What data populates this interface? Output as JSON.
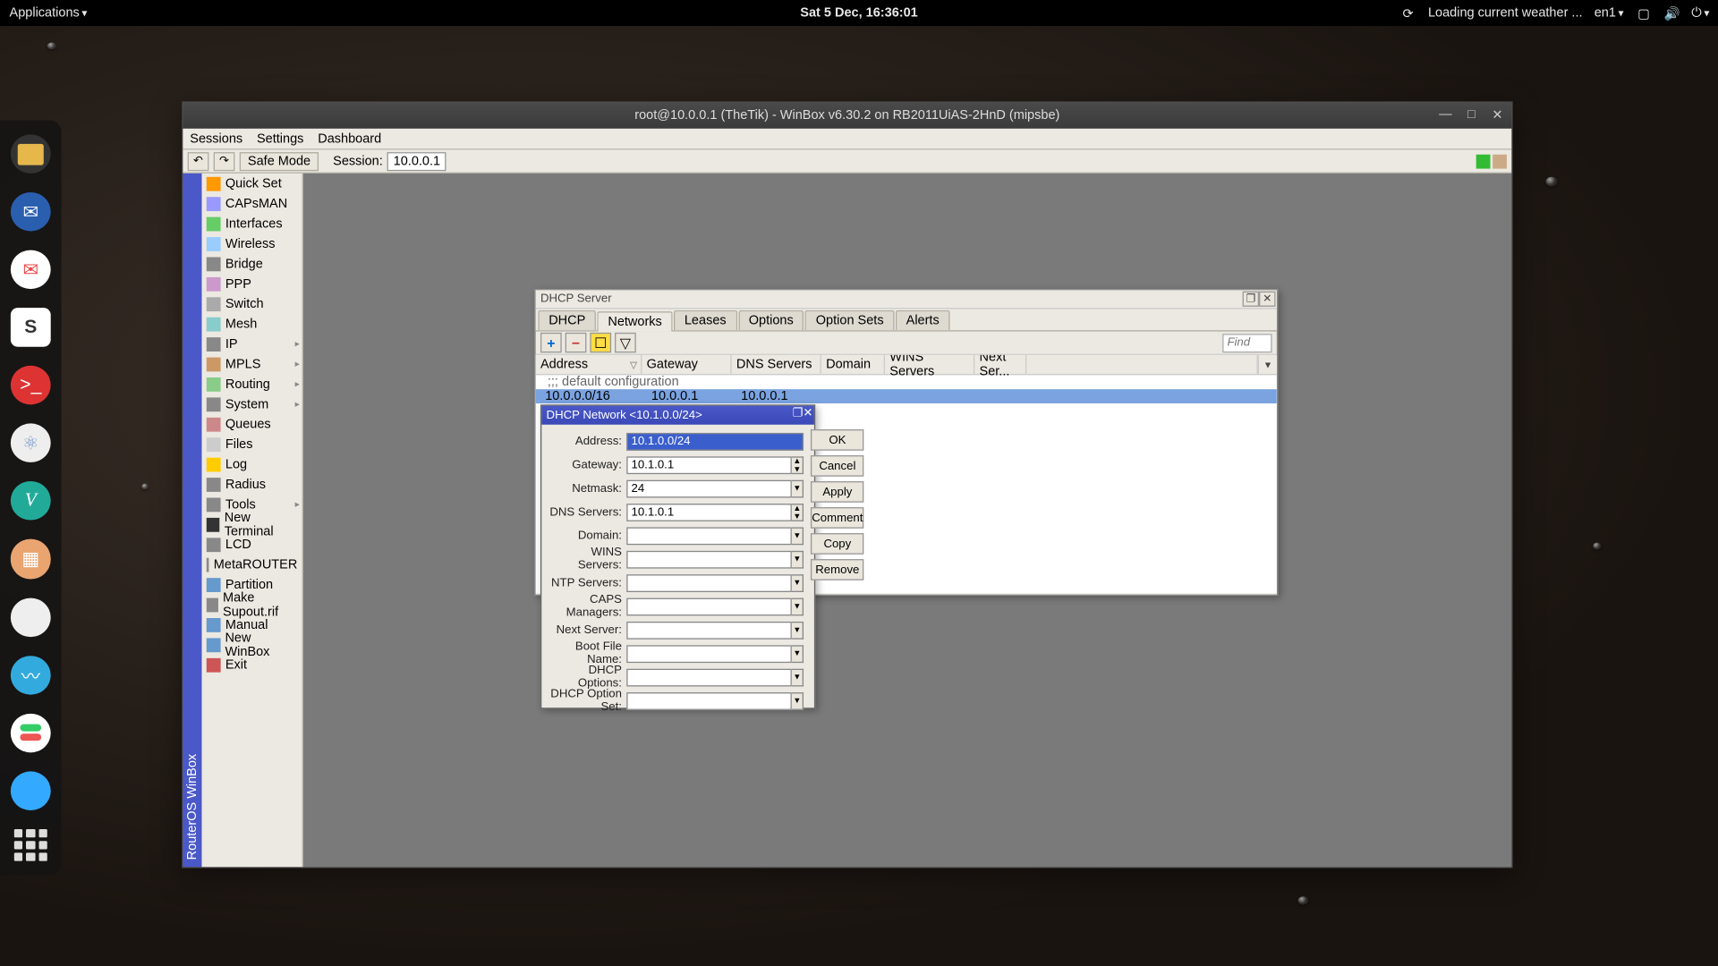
{
  "sysbar": {
    "applications": "Applications",
    "datetime": "Sat  5 Dec, 16:36:01",
    "weather": "Loading current weather ...",
    "lang": "en1"
  },
  "appwin": {
    "title": "root@10.0.0.1 (TheTik) - WinBox v6.30.2 on RB2011UiAS-2HnD (mipsbe)",
    "menus": {
      "sessions": "Sessions",
      "settings": "Settings",
      "dashboard": "Dashboard"
    },
    "toolbar": {
      "safemode": "Safe Mode",
      "session_label": "Session:",
      "session_value": "10.0.0.1"
    },
    "vstrip": "RouterOS WinBox",
    "sidebar": [
      {
        "label": "Quick Set",
        "sub": false
      },
      {
        "label": "CAPsMAN",
        "sub": false
      },
      {
        "label": "Interfaces",
        "sub": false
      },
      {
        "label": "Wireless",
        "sub": false
      },
      {
        "label": "Bridge",
        "sub": false
      },
      {
        "label": "PPP",
        "sub": false
      },
      {
        "label": "Switch",
        "sub": false
      },
      {
        "label": "Mesh",
        "sub": false
      },
      {
        "label": "IP",
        "sub": true
      },
      {
        "label": "MPLS",
        "sub": true
      },
      {
        "label": "Routing",
        "sub": true
      },
      {
        "label": "System",
        "sub": true
      },
      {
        "label": "Queues",
        "sub": false
      },
      {
        "label": "Files",
        "sub": false
      },
      {
        "label": "Log",
        "sub": false
      },
      {
        "label": "Radius",
        "sub": false
      },
      {
        "label": "Tools",
        "sub": true
      },
      {
        "label": "New Terminal",
        "sub": false
      },
      {
        "label": "LCD",
        "sub": false
      },
      {
        "label": "MetaROUTER",
        "sub": false
      },
      {
        "label": "Partition",
        "sub": false
      },
      {
        "label": "Make Supout.rif",
        "sub": false
      },
      {
        "label": "Manual",
        "sub": false
      },
      {
        "label": "New WinBox",
        "sub": false
      },
      {
        "label": "Exit",
        "sub": false
      }
    ]
  },
  "dhcp": {
    "title": "DHCP Server",
    "tabs": [
      "DHCP",
      "Networks",
      "Leases",
      "Options",
      "Option Sets",
      "Alerts"
    ],
    "active_tab": 1,
    "find_placeholder": "Find",
    "columns": [
      "Address",
      "Gateway",
      "DNS Servers",
      "Domain",
      "WINS Servers",
      "Next Ser..."
    ],
    "comment_row": ";;; default configuration",
    "row": {
      "address": "10.0.0.0/16",
      "gateway": "10.0.0.1",
      "dns": "10.0.0.1",
      "domain": "",
      "wins": "",
      "next": ""
    }
  },
  "netdlg": {
    "title": "DHCP Network <10.1.0.0/24>",
    "fields": {
      "address": {
        "label": "Address:",
        "value": "10.1.0.0/24",
        "sel": true,
        "ctrl": "plain"
      },
      "gateway": {
        "label": "Gateway:",
        "value": "10.1.0.1",
        "ctrl": "spin"
      },
      "netmask": {
        "label": "Netmask:",
        "value": "24",
        "ctrl": "drop"
      },
      "dns": {
        "label": "DNS Servers:",
        "value": "10.1.0.1",
        "ctrl": "spin"
      },
      "domain": {
        "label": "Domain:",
        "value": "",
        "ctrl": "drop"
      },
      "wins": {
        "label": "WINS Servers:",
        "value": "",
        "ctrl": "drop"
      },
      "ntp": {
        "label": "NTP Servers:",
        "value": "",
        "ctrl": "drop"
      },
      "caps": {
        "label": "CAPS Managers:",
        "value": "",
        "ctrl": "drop"
      },
      "next": {
        "label": "Next Server:",
        "value": "",
        "ctrl": "drop"
      },
      "boot": {
        "label": "Boot File Name:",
        "value": "",
        "ctrl": "drop"
      },
      "opts": {
        "label": "DHCP Options:",
        "value": "",
        "ctrl": "drop"
      },
      "optset": {
        "label": "DHCP Option Set:",
        "value": "",
        "ctrl": "drop"
      }
    },
    "buttons": [
      "OK",
      "Cancel",
      "Apply",
      "Comment",
      "Copy",
      "Remove"
    ]
  },
  "icon_colors": {
    "files": "#e6b84c",
    "thunderbird": "#2a5fb0",
    "mail": "#e44",
    "slack": "#fff",
    "term": "#d33",
    "atom": "#eee",
    "vim": "#2a9",
    "box": "#e88",
    "egg": "#eee",
    "monitor": "#3ad",
    "toggle": "#3c6",
    "marble": "#3af"
  }
}
